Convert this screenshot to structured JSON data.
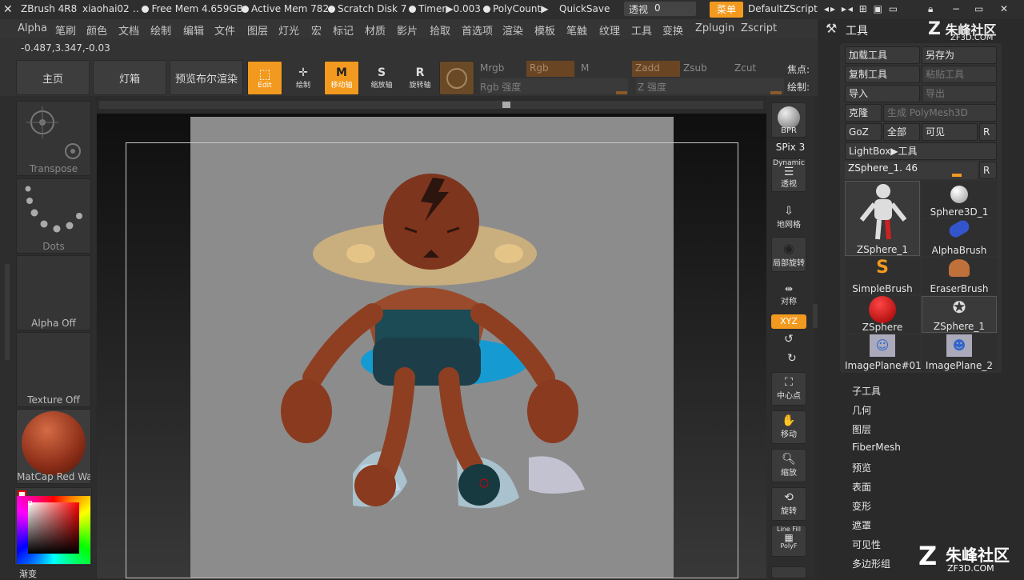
{
  "titlebar": {
    "app": "ZBrush 4R8",
    "user": "xiaohai02",
    "free_mem": "Free Mem 4.659GB",
    "active_mem": "Active Mem 782",
    "scratch_disk": "Scratch Disk 7",
    "timer": "Timer▶0.003",
    "polycount": "PolyCount▶",
    "quicksave": "QuickSave",
    "transparency_label": "透视",
    "transparency_value": "0",
    "menu_btn": "菜单",
    "script": "DefaultZScript"
  },
  "menubar": [
    "Alpha",
    "笔刷",
    "颜色",
    "文档",
    "绘制",
    "编辑",
    "文件",
    "图层",
    "灯光",
    "宏",
    "标记",
    "材质",
    "影片",
    "拾取",
    "首选项",
    "渲染",
    "模板",
    "笔触",
    "纹理",
    "工具",
    "变换",
    "Zplugin",
    "Zscript"
  ],
  "coords": "-0.487,3.347,-0.03",
  "toolbar": {
    "home": "主页",
    "lightbox": "灯箱",
    "bpr_preview": "预览布尔渲染",
    "edit": "Edit",
    "draw": "绘制",
    "move": "移动轴",
    "scale": "缩放轴",
    "rotate": "旋转轴",
    "mrgb": "Mrgb",
    "rgb": "Rgb",
    "m": "M",
    "rgb_intensity": "Rgb 强度",
    "zadd": "Zadd",
    "zsub": "Zsub",
    "zcut": "Zcut",
    "z_intensity": "Z 强度",
    "focal": "焦点:",
    "draw_size": "绘制:"
  },
  "left_panel": {
    "transpose": "Transpose",
    "dots": "Dots",
    "alpha": "Alpha Off",
    "texture": "Texture Off",
    "material": "MatCap Red Wax",
    "gradient": "渐变"
  },
  "right_strip": {
    "bpr": "BPR",
    "spix": "SPix 3",
    "dynamic": "Dynamic",
    "persp": "透视",
    "floor": "地网格",
    "local": "局部旋转",
    "symmetry": "对称",
    "xyz": "XYZ",
    "center": "中心点",
    "move": "移动",
    "zoom": "缩放",
    "rotate": "旋转",
    "linefill": "Line Fill",
    "polyf": "PolyF"
  },
  "tool_panel": {
    "title": "工具",
    "load_tool": "加载工具",
    "save_as": "另存为",
    "copy_tool": "复制工具",
    "paste_tool": "粘贴工具",
    "import": "导入",
    "export": "导出",
    "clone": "克隆",
    "make_polymesh": "生成 PolyMesh3D",
    "goz": "GoZ",
    "all": "全部",
    "visible": "可见",
    "r": "R",
    "lightbox_tool": "LightBox▶工具",
    "current_tool": "ZSphere_1. 46",
    "tools": [
      "ZSphere_1",
      "Sphere3D_1",
      "AlphaBrush",
      "SimpleBrush",
      "EraserBrush",
      "ZSphere",
      "ZSphere_1",
      "ImagePlane#01",
      "ImagePlane_2"
    ],
    "subpalettes": [
      "子工具",
      "几何",
      "图层",
      "FiberMesh",
      "预览",
      "表面",
      "变形",
      "遮罩",
      "可见性",
      "多边形组"
    ]
  },
  "watermark": {
    "brand": "朱峰社区",
    "site": "ZF3D.COM"
  }
}
